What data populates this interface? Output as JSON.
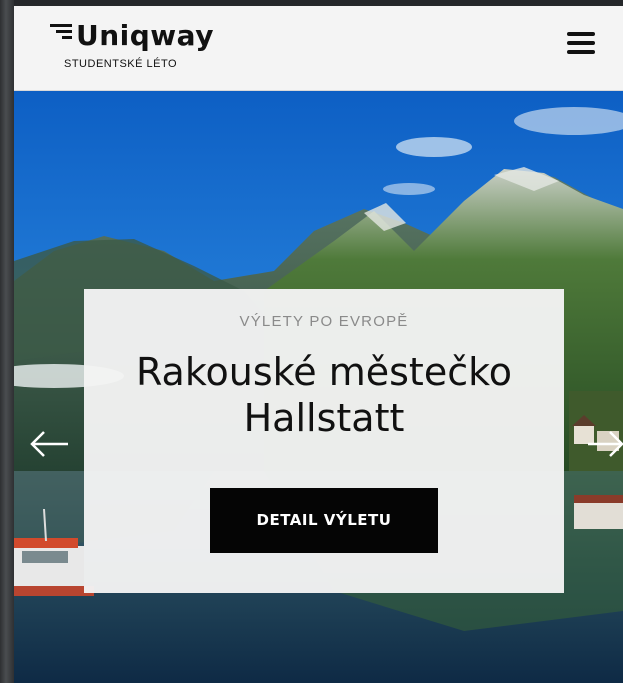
{
  "header": {
    "brand_name": "Uniqway",
    "brand_tagline": "STUDENTSKÉ LÉTO",
    "menu_icon": "hamburger-menu-icon"
  },
  "hero": {
    "kicker": "VÝLETY PO EVROPĚ",
    "title_line1": "Rakouské městečko",
    "title_line2": "Hallstatt",
    "cta_label": "DETAIL VÝLETU",
    "prev_icon": "arrow-left-icon",
    "next_icon": "arrow-right-icon"
  },
  "colors": {
    "header_bg": "#f4f4f4",
    "text_dark": "#111111",
    "kicker_gray": "#8a8a8a",
    "button_bg": "#050505",
    "button_text": "#ffffff"
  }
}
